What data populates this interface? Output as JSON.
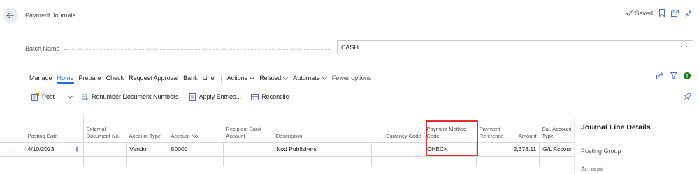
{
  "header": {
    "title": "Payment Journals",
    "saved_label": "Saved"
  },
  "batch": {
    "label": "Batch Name",
    "value": "CASH",
    "assist": "···"
  },
  "actionbar": {
    "items": [
      "Manage",
      "Home",
      "Prepare",
      "Check",
      "Request Approval",
      "Bank",
      "Line"
    ],
    "active": "Home",
    "dropdowns": [
      "Actions",
      "Related",
      "Automate"
    ],
    "fewer": "Fewer options"
  },
  "toolbar": {
    "post": "Post",
    "renumber": "Renumber Document Numbers",
    "apply": "Apply Entries...",
    "reconcile": "Reconcile"
  },
  "grid": {
    "columns": {
      "posting_date": "Posting Date",
      "external_doc": "External Document No.",
      "account_type": "Account Type",
      "account_no": "Account No.",
      "recipient_bank": "Recipient Bank Account",
      "description": "Description",
      "currency": "Currency Code",
      "payment_method": "Payment Method Code",
      "payment_ref": "Payment Reference",
      "amount": "Amount",
      "bal_account_type": "Bal. Account Type"
    },
    "rows": [
      {
        "posting_date": "4/10/2023",
        "external_doc": "",
        "account_type": "Vendor",
        "account_no": "50000",
        "recipient_bank": "",
        "description": "Nod Publishers",
        "currency": "",
        "payment_method": "CHECK",
        "payment_ref": "",
        "amount": "2,378.11",
        "bal_account_type": "G/L Accour"
      }
    ]
  },
  "side_panel": {
    "title": "Journal Line Details",
    "label_posting_group": "Posting Group",
    "label_account": "Account"
  },
  "colors": {
    "accent": "#2b6cd2",
    "highlight": "#e0312f",
    "info_badge": "#107c10"
  }
}
